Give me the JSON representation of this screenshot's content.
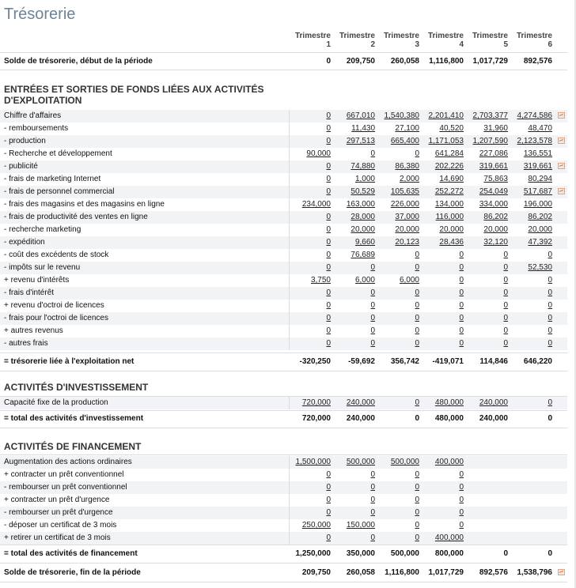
{
  "title": "Trésorerie",
  "columns": [
    {
      "line1": "Trimestre",
      "line2": "1"
    },
    {
      "line1": "Trimestre",
      "line2": "2"
    },
    {
      "line1": "Trimestre",
      "line2": "3"
    },
    {
      "line1": "Trimestre",
      "line2": "4"
    },
    {
      "line1": "Trimestre",
      "line2": "5"
    },
    {
      "line1": "Trimestre",
      "line2": "6"
    }
  ],
  "opening": {
    "label": "Solde de trésorerie, début de la période",
    "values": [
      "0",
      "209,750",
      "260,058",
      "1,116,800",
      "1,017,729",
      "892,576"
    ]
  },
  "sections": {
    "operating": {
      "title": "ENTRÉES ET SORTIES DE FONDS LIÉES AUX ACTIVITÉS D'EXPLOITATION",
      "rows": [
        {
          "label": "Chiffre d'affaires",
          "values": [
            "0",
            "667,010",
            "1,540,380",
            "2,201,410",
            "2,703,377",
            "4,274,586"
          ],
          "chart": true
        },
        {
          "label": "- remboursements",
          "values": [
            "0",
            "11,430",
            "27,100",
            "40,520",
            "31,960",
            "48,470"
          ],
          "chart": false
        },
        {
          "label": "- production",
          "values": [
            "0",
            "297,513",
            "665,400",
            "1,171,053",
            "1,207,590",
            "2,123,578"
          ],
          "chart": true
        },
        {
          "label": "- Recherche et développement",
          "values": [
            "90,000",
            "0",
            "0",
            "641,284",
            "227,086",
            "136,551"
          ],
          "chart": false
        },
        {
          "label": "- publicité",
          "values": [
            "0",
            "74,880",
            "86,380",
            "202,226",
            "319,661",
            "319,661"
          ],
          "chart": true
        },
        {
          "label": "- frais de marketing Internet",
          "values": [
            "0",
            "1,000",
            "2,000",
            "14,690",
            "75,863",
            "80,294"
          ],
          "chart": false
        },
        {
          "label": "- frais de personnel commercial",
          "values": [
            "0",
            "50,529",
            "105,635",
            "252,272",
            "254,049",
            "517,687"
          ],
          "chart": true
        },
        {
          "label": "- frais des magasins et des magasins en ligne",
          "values": [
            "234,000",
            "163,000",
            "226,000",
            "134,000",
            "334,000",
            "196,000"
          ],
          "chart": false
        },
        {
          "label": "- frais de productivité des ventes en ligne",
          "values": [
            "0",
            "28,000",
            "37,000",
            "116,000",
            "86,202",
            "86,202"
          ],
          "chart": false
        },
        {
          "label": "- recherche marketing",
          "values": [
            "0",
            "20,000",
            "20,000",
            "20,000",
            "20,000",
            "20,000"
          ],
          "chart": false
        },
        {
          "label": "- expédition",
          "values": [
            "0",
            "9,660",
            "20,123",
            "28,436",
            "32,120",
            "47,392"
          ],
          "chart": false
        },
        {
          "label": "- coût des excédents de stock",
          "values": [
            "0",
            "76,689",
            "0",
            "0",
            "0",
            "0"
          ],
          "chart": false
        },
        {
          "label": "- impôts sur le revenu",
          "values": [
            "0",
            "0",
            "0",
            "0",
            "0",
            "52,530"
          ],
          "chart": false
        },
        {
          "label": "+ revenu d'intérêts",
          "values": [
            "3,750",
            "6,000",
            "6,000",
            "0",
            "0",
            "0"
          ],
          "chart": false
        },
        {
          "label": "- frais d'intérêt",
          "values": [
            "0",
            "0",
            "0",
            "0",
            "0",
            "0"
          ],
          "chart": false
        },
        {
          "label": "+ revenu d'octroi de licences",
          "values": [
            "0",
            "0",
            "0",
            "0",
            "0",
            "0"
          ],
          "chart": false
        },
        {
          "label": "- frais pour l'octroi de licences",
          "values": [
            "0",
            "0",
            "0",
            "0",
            "0",
            "0"
          ],
          "chart": false
        },
        {
          "label": "+ autres revenus",
          "values": [
            "0",
            "0",
            "0",
            "0",
            "0",
            "0"
          ],
          "chart": false
        },
        {
          "label": "- autres frais",
          "values": [
            "0",
            "0",
            "0",
            "0",
            "0",
            "0"
          ],
          "chart": false
        }
      ],
      "total": {
        "label": "= trésorerie liée à l'exploitation net",
        "values": [
          "-320,250",
          "-59,692",
          "356,742",
          "-419,071",
          "114,846",
          "646,220"
        ]
      }
    },
    "investing": {
      "title": "ACTIVITÉS D'INVESTISSEMENT",
      "rows": [
        {
          "label": "Capacité fixe de la production",
          "values": [
            "720,000",
            "240,000",
            "0",
            "480,000",
            "240,000",
            "0"
          ],
          "chart": false
        }
      ],
      "total": {
        "label": "= total des activités d'investissement",
        "values": [
          "720,000",
          "240,000",
          "0",
          "480,000",
          "240,000",
          "0"
        ]
      }
    },
    "financing": {
      "title": "ACTIVITÉS DE FINANCEMENT",
      "rows": [
        {
          "label": "Augmentation des actions ordinaires",
          "values": [
            "1,500,000",
            "500,000",
            "500,000",
            "400,000",
            "",
            ""
          ],
          "chart": false
        },
        {
          "label": "+ contracter un prêt conventionnel",
          "values": [
            "0",
            "0",
            "0",
            "0",
            "",
            ""
          ],
          "chart": false
        },
        {
          "label": "- rembourser un prêt conventionnel",
          "values": [
            "0",
            "0",
            "0",
            "0",
            "",
            ""
          ],
          "chart": false
        },
        {
          "label": "+ contracter un prêt d'urgence",
          "values": [
            "0",
            "0",
            "0",
            "0",
            "",
            ""
          ],
          "chart": false
        },
        {
          "label": "- rembourser un prêt d'urgence",
          "values": [
            "0",
            "0",
            "0",
            "0",
            "",
            ""
          ],
          "chart": false
        },
        {
          "label": "- déposer un certificat de 3 mois",
          "values": [
            "250,000",
            "150,000",
            "0",
            "0",
            "",
            ""
          ],
          "chart": false
        },
        {
          "label": "+ retirer un certificat de 3 mois",
          "values": [
            "0",
            "0",
            "0",
            "400,000",
            "",
            ""
          ],
          "chart": false
        }
      ],
      "total": {
        "label": "= total des activités de financement",
        "values": [
          "1,250,000",
          "350,000",
          "500,000",
          "800,000",
          "0",
          "0"
        ]
      }
    }
  },
  "closing": {
    "label": "Solde de trésorerie, fin de la période",
    "values": [
      "209,750",
      "260,058",
      "1,116,800",
      "1,017,729",
      "892,576",
      "1,538,796"
    ],
    "chart": true
  },
  "colors": {
    "title": "#6f8396",
    "shaded_row": "#f1f3f6",
    "chart_icon": "#e8a27c"
  }
}
